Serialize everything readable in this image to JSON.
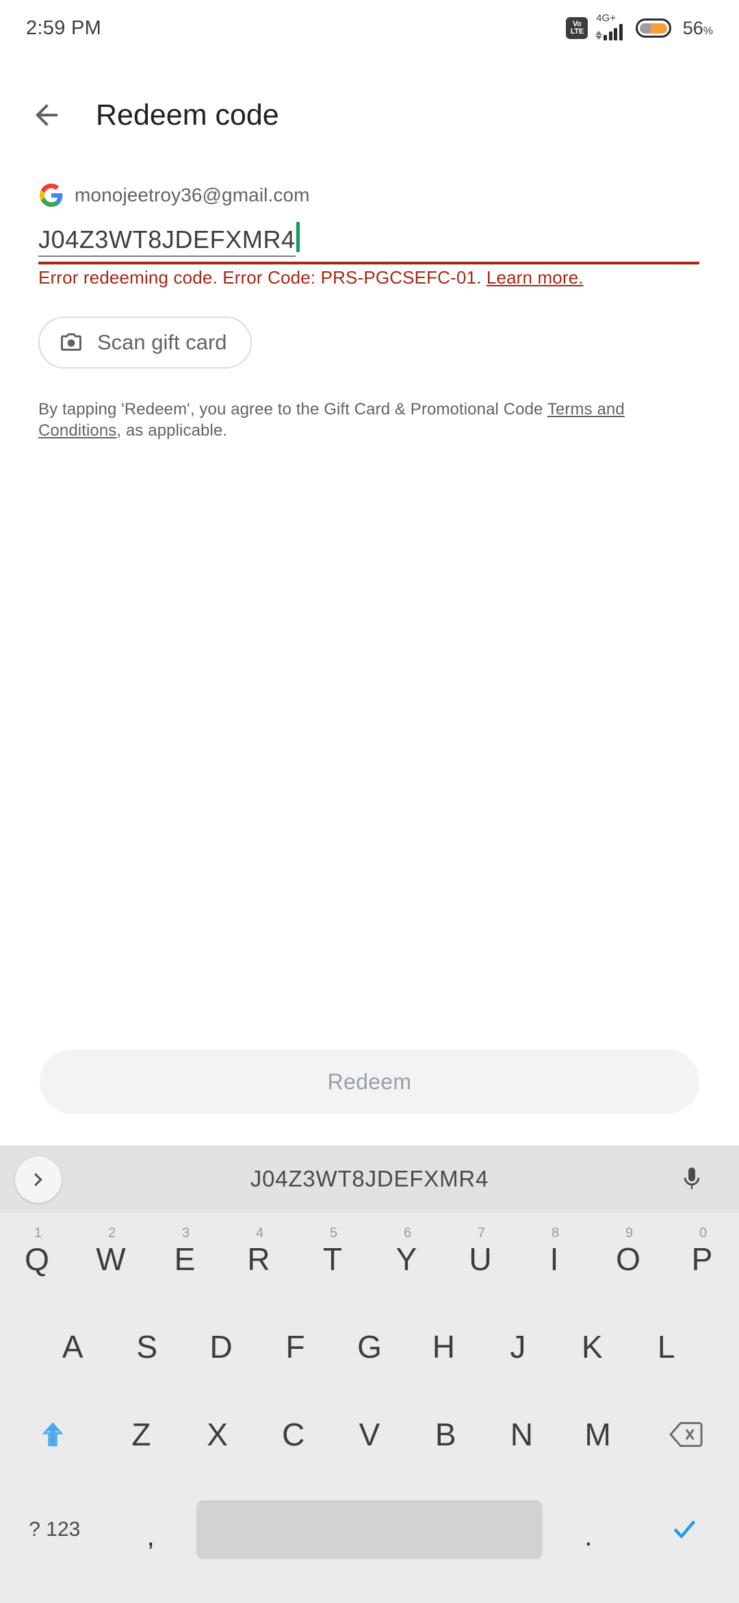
{
  "status_bar": {
    "time": "2:59 PM",
    "volte_line1": "Vo",
    "volte_line2": "LTE",
    "network": "4G+",
    "battery_percent": "56",
    "battery_percent_symbol": "%"
  },
  "app_bar": {
    "back_icon": "back-arrow-icon",
    "title": "Redeem code"
  },
  "content": {
    "account_icon": "google-g-icon",
    "account_email": "monojeetroy36@gmail.com",
    "code_value": "J04Z3WT8JDEFXMR4",
    "error_message": "Error redeeming code. Error Code: PRS-PGCSEFC-01.",
    "error_link": "Learn more.",
    "scan_icon": "camera-icon",
    "scan_label": "Scan gift card",
    "terms_prefix": "By tapping 'Redeem', you agree to the Gift Card & Promotional Code ",
    "terms_link": "Terms and Conditions",
    "terms_suffix": ", as applicable.",
    "redeem_label": "Redeem"
  },
  "keyboard": {
    "expand_icon": "chevron-right-icon",
    "suggestion": "J04Z3WT8JDEFXMR4",
    "mic_icon": "microphone-icon",
    "row1": [
      {
        "key": "Q",
        "num": "1"
      },
      {
        "key": "W",
        "num": "2"
      },
      {
        "key": "E",
        "num": "3"
      },
      {
        "key": "R",
        "num": "4"
      },
      {
        "key": "T",
        "num": "5"
      },
      {
        "key": "Y",
        "num": "6"
      },
      {
        "key": "U",
        "num": "7"
      },
      {
        "key": "I",
        "num": "8"
      },
      {
        "key": "O",
        "num": "9"
      },
      {
        "key": "P",
        "num": "0"
      }
    ],
    "row2": [
      "A",
      "S",
      "D",
      "F",
      "G",
      "H",
      "J",
      "K",
      "L"
    ],
    "row3_letters": [
      "Z",
      "X",
      "C",
      "V",
      "B",
      "N",
      "M"
    ],
    "shift_icon": "shift-up-arrow-icon",
    "backspace_icon": "backspace-icon",
    "symbols_label": "? 123",
    "comma": ",",
    "period": ".",
    "space_label": "",
    "enter_icon": "checkmark-enter-icon"
  },
  "colors": {
    "error_red": "#a52714",
    "caret_green": "#0f9d58",
    "accent_blue": "#4aa8ef",
    "battery_orange": "#f4a13a",
    "keyboard_bg": "#ebebeb",
    "suggestion_bg": "#e2e2e2"
  }
}
